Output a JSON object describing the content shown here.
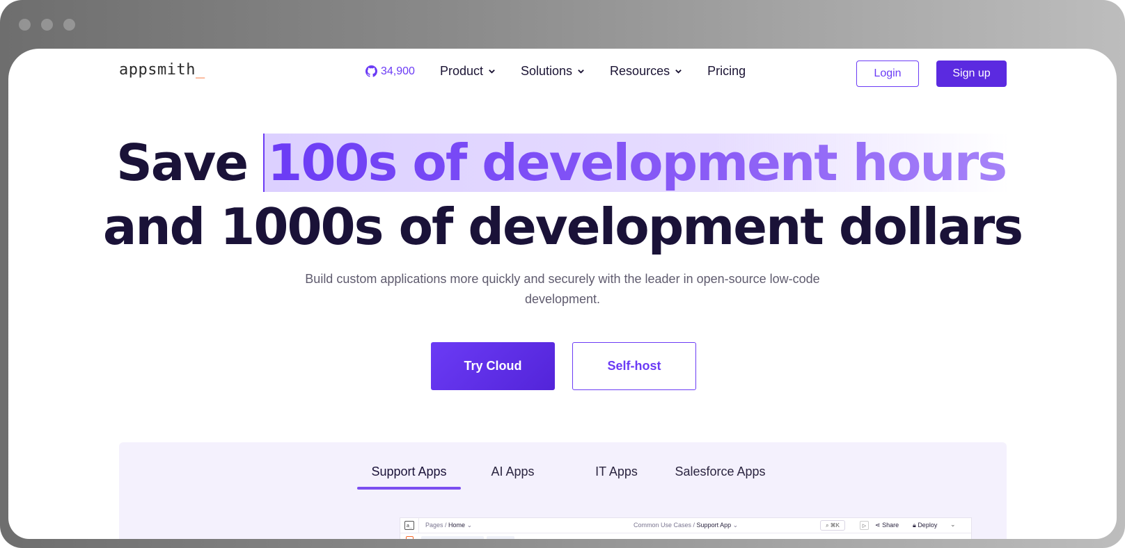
{
  "nav": {
    "logo_text": "appsmith",
    "logo_cursor": "_",
    "github_stars": "34,900",
    "items": [
      {
        "label": "Product"
      },
      {
        "label": "Solutions"
      },
      {
        "label": "Resources"
      }
    ],
    "pricing": "Pricing",
    "login": "Login",
    "signup": "Sign up"
  },
  "hero": {
    "line1_prefix": "Save ",
    "line1_highlight": "100s of development hours",
    "line2": "and 1000s of development dollars",
    "subtitle": "Build custom applications more quickly and securely with the leader in open-source low-code development.",
    "cta_primary": "Try Cloud",
    "cta_secondary": "Self-host"
  },
  "showcase": {
    "tabs": [
      {
        "label": "Support Apps",
        "active": true
      },
      {
        "label": "AI Apps",
        "active": false
      },
      {
        "label": "IT Apps",
        "active": false
      },
      {
        "label": "Salesforce Apps",
        "active": false
      }
    ]
  },
  "preview": {
    "logo": "a_",
    "pages_label": "Pages /",
    "pages_current": "Home",
    "crumb_root": "Common Use Cases /",
    "crumb_app": "Support App",
    "search_hint": "⌘K",
    "share": "Share",
    "deploy": "Deploy"
  },
  "colors": {
    "brand": "#6b3bf5",
    "brand_dark": "#5b2ae0",
    "heading": "#1a1238",
    "accent_orange": "#f86a2b",
    "showcase_bg": "#f4f1fd"
  },
  "icons": {
    "github": "github-icon",
    "chevron": "chevron-down-icon"
  }
}
